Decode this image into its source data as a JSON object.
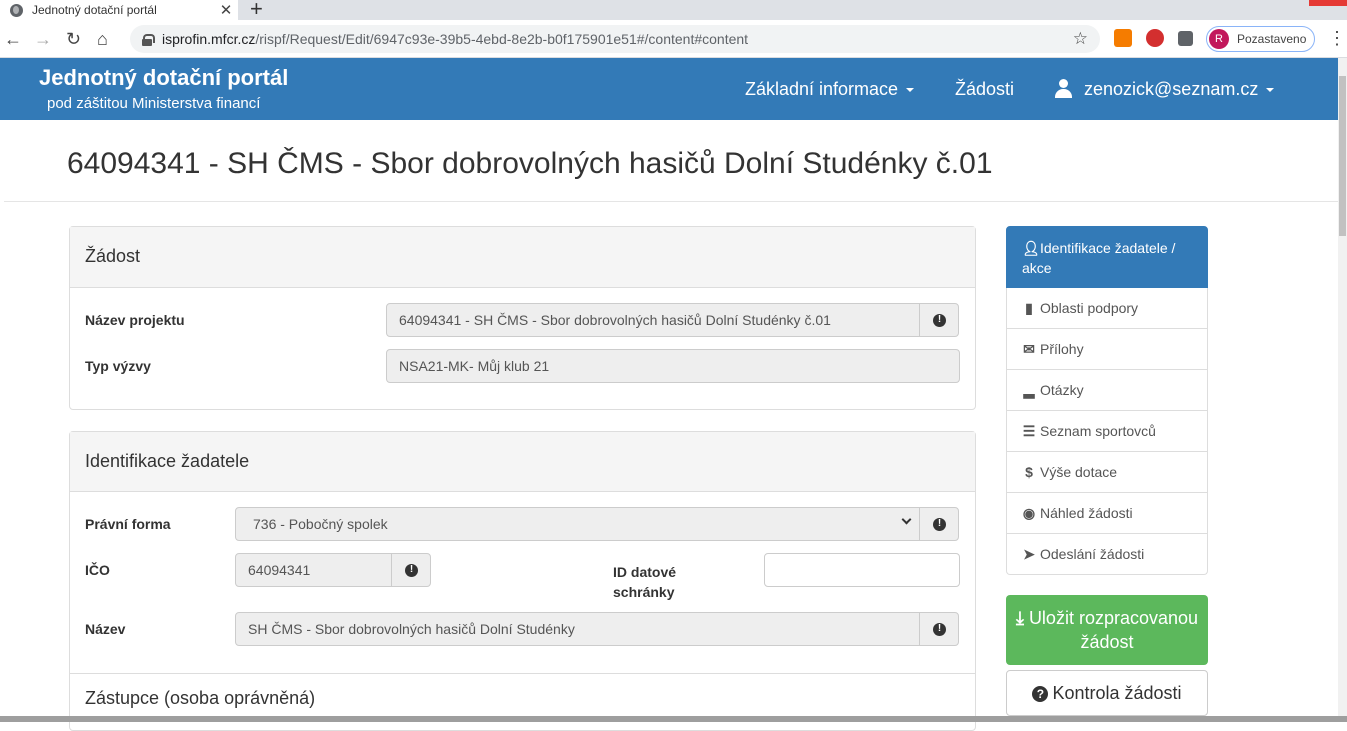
{
  "browser": {
    "tab_title": "Jednotný dotační portál",
    "url_domain": "isprofin.mfcr.cz",
    "url_path": "/rispf/Request/Edit/6947c93e-39b5-4ebd-8e2b-b0f175901e51#/content#content",
    "profile_initial": "R",
    "profile_status": "Pozastaveno"
  },
  "navbar": {
    "brand_title": "Jednotný dotační portál",
    "brand_subtitle": "pod záštitou Ministerstva financí",
    "links": [
      "Základní informace",
      "Žádosti"
    ],
    "user": "zenozick@seznam.cz"
  },
  "page": {
    "title": "64094341 - SH ČMS - Sbor dobrovolných hasičů Dolní Studénky č.01"
  },
  "zadost": {
    "heading": "Žádost",
    "nazev_label": "Název projektu",
    "nazev_value": "64094341 - SH ČMS - Sbor dobrovolných hasičů Dolní Studénky č.01",
    "typ_label": "Typ výzvy",
    "typ_value": "NSA21-MK- Můj klub 21"
  },
  "identifikace": {
    "heading": "Identifikace žadatele",
    "pravni_label": "Právní forma",
    "pravni_value": "736 - Pobočný spolek",
    "ico_label": "IČO",
    "ico_value": "64094341",
    "ds_label_1": "ID datové",
    "ds_label_2": "schránky",
    "ds_value": "",
    "nazev_label": "Název",
    "nazev_value": "SH ČMS - Sbor dobrovolných hasičů Dolní Studénky"
  },
  "zastupce": {
    "heading": "Zástupce (osoba oprávněná)"
  },
  "sidenav": {
    "items": [
      {
        "label": "Identifikace žadatele / akce",
        "icon": "user-icon"
      },
      {
        "label": "Oblasti podpory",
        "icon": "book-icon"
      },
      {
        "label": "Přílohy",
        "icon": "envelope-icon"
      },
      {
        "label": "Otázky",
        "icon": "signal-icon"
      },
      {
        "label": "Seznam sportovců",
        "icon": "list-icon"
      },
      {
        "label": "Výše dotace",
        "icon": "dollar-icon"
      },
      {
        "label": "Náhled žádosti",
        "icon": "eye-icon"
      },
      {
        "label": "Odeslání žádosti",
        "icon": "send-icon"
      }
    ]
  },
  "actions": {
    "save_line1": "Uložit rozpracovanou",
    "save_line2": "žádost",
    "check": "Kontrola žádosti"
  },
  "colors": {
    "primary": "#337ab7",
    "success": "#5cb85c"
  }
}
